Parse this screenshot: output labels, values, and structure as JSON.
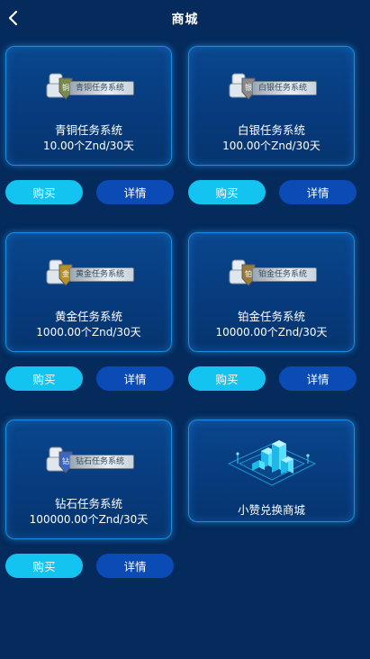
{
  "header": {
    "title": "商城"
  },
  "products": [
    {
      "name": "青铜任务系统",
      "price": "10.00个Znd/30天",
      "badge_text": "青铜任务系统",
      "color": "#7a8a4a"
    },
    {
      "name": "白银任务系统",
      "price": "100.00个Znd/30天",
      "badge_text": "白银任务系统",
      "color": "#8a8a8a"
    },
    {
      "name": "黄金任务系统",
      "price": "1000.00个Znd/30天",
      "badge_text": "黄金任务系统",
      "color": "#b8902a"
    },
    {
      "name": "铂金任务系统",
      "price": "10000.00个Znd/30天",
      "badge_text": "铂金任务系统",
      "color": "#9a7a3a"
    },
    {
      "name": "钻石任务系统",
      "price": "100000.00个Znd/30天",
      "badge_text": "钻石任务系统",
      "color": "#3a66c8"
    }
  ],
  "exchange_card": {
    "name": "小赞兑换商城"
  },
  "buttons": {
    "buy": "购买",
    "detail": "详情"
  }
}
